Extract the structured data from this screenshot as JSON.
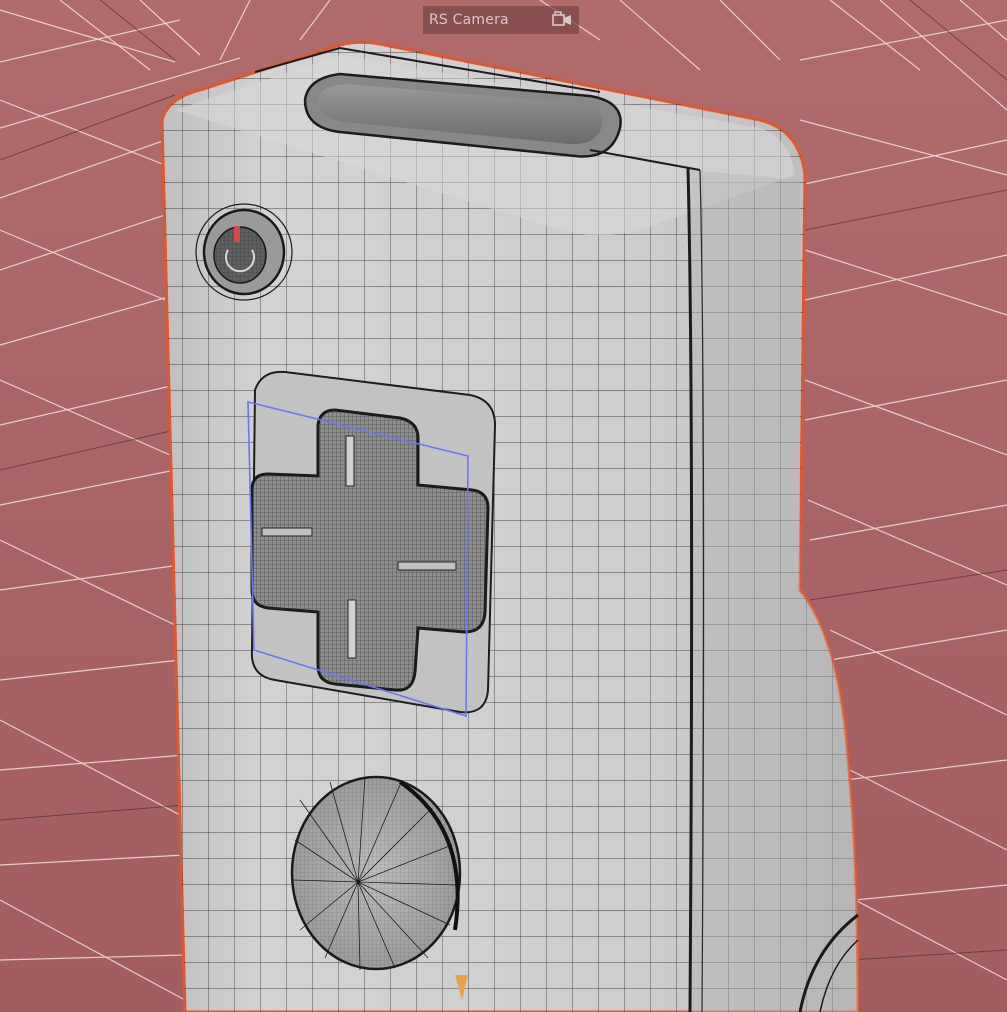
{
  "viewport": {
    "camera_label": "RS Camera",
    "camera_icon": "camera-lock-icon"
  },
  "colors": {
    "floor": "#a86565",
    "floor_grid": "#f0d7d7",
    "model_fill": "#c8c8c8",
    "model_wire": "#1e1e1e",
    "selection_outline": "#e2572b",
    "selection_box": "#6c73ff"
  }
}
